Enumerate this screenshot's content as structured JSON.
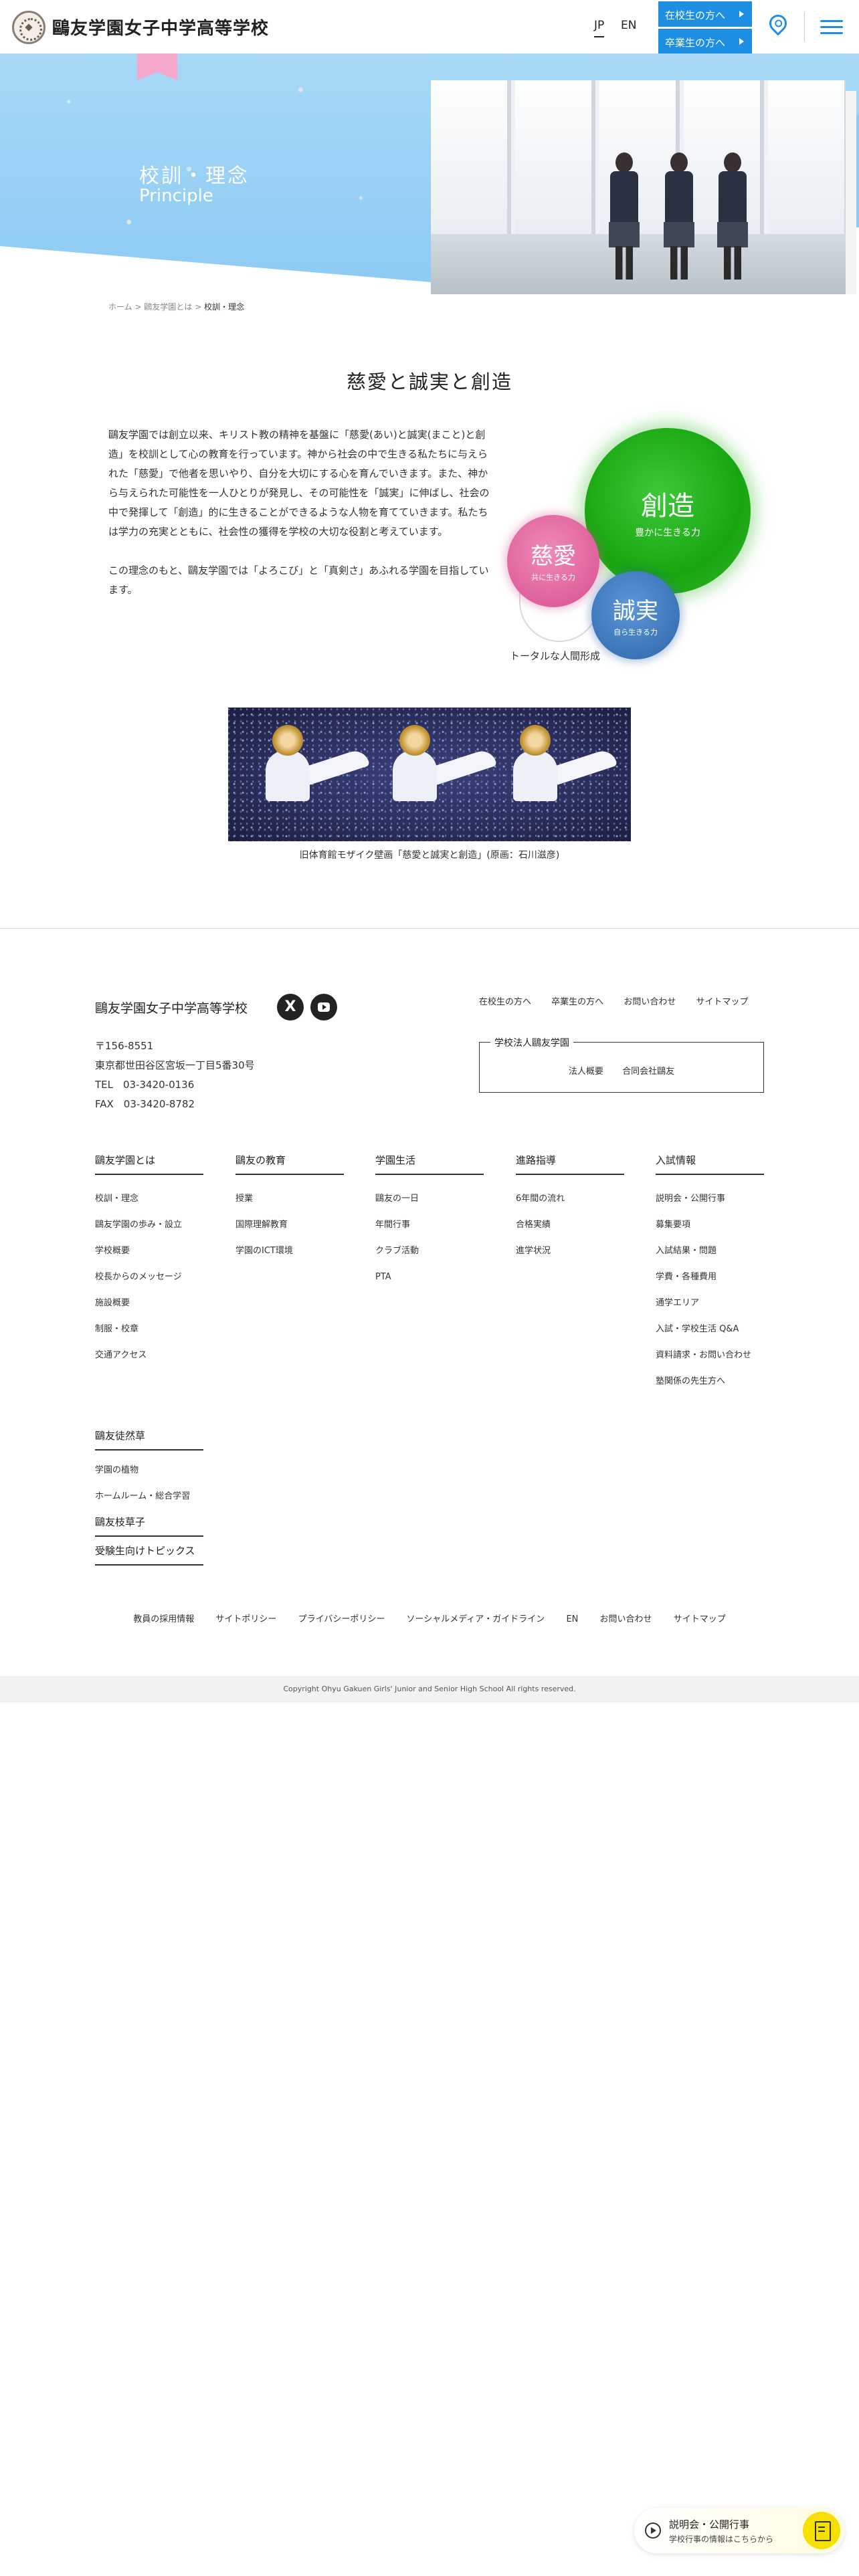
{
  "header": {
    "site_title": "鷗友学園女子中学高等学校",
    "lang_jp": "JP",
    "lang_en": "EN",
    "btn_current": "在校生の方へ",
    "btn_alumni": "卒業生の方へ",
    "accent_color": "#1e8ee3"
  },
  "hero": {
    "title": "校訓・理念",
    "subtitle": "Principle"
  },
  "breadcrumb": {
    "home": "ホーム",
    "parent": "鷗友学園とは",
    "current": "校訓・理念",
    "sep": ">"
  },
  "main": {
    "section_title": "慈愛と誠実と創造",
    "paragraph1": "鷗友学園では創立以来、キリスト教の精神を基盤に「慈愛(あい)と誠実(まこと)と創造」を校訓として心の教育を行っています。神から社会の中で生きる私たちに与えられた「慈愛」で他者を思いやり、自分を大切にする心を育んでいきます。また、神から与えられた可能性を一人ひとりが発見し、その可能性を「誠実」に伸ばし、社会の中で発揮して「創造」的に生きることができるような人物を育てていきます。私たちは学力の充実とともに、社会性の獲得を学校の大切な役割と考えています。",
    "paragraph2": "この理念のもと、鷗友学園では「よろこび」と「真剣さ」あふれる学園を目指しています。",
    "diagram": {
      "create_title": "創造",
      "create_sub": "豊かに生きる力",
      "love_title": "慈愛",
      "love_sub": "共に生きる力",
      "sincere_title": "誠実",
      "sincere_sub": "自ら生きる力",
      "caption": "トータルな人間形成",
      "colors": {
        "create": "#17a60f",
        "love": "#d74f8f",
        "sincere": "#2d64aa"
      }
    },
    "mosaic_caption": "旧体育館モザイク壁画「慈愛と誠実と創造」(原画：石川滋彦)"
  },
  "footer": {
    "school_name": "鷗友学園女子中学高等学校",
    "x_icon": "X",
    "postal": "〒156-8551",
    "address": "東京都世田谷区宮坂一丁目5番30号",
    "tel": "TEL　03-3420-0136",
    "fax": "FAX　03-3420-8782",
    "top_links": [
      "在校生の方へ",
      "卒業生の方へ",
      "お問い合わせ",
      "サイトマップ"
    ],
    "corp_title": "学校法人鷗友学園",
    "corp_links": [
      "法人概要",
      "合同会社鷗友"
    ],
    "columns": [
      {
        "title": "鷗友学園とは",
        "items": [
          "校訓・理念",
          "鷗友学園の歩み・設立",
          "学校概要",
          "校長からのメッセージ",
          "施設概要",
          "制服・校章",
          "交通アクセス"
        ]
      },
      {
        "title": "鷗友の教育",
        "items": [
          "授業",
          "国際理解教育",
          "学園のICT環境"
        ]
      },
      {
        "title": "学園生活",
        "items": [
          "鷗友の一日",
          "年間行事",
          "クラブ活動",
          "PTA"
        ]
      },
      {
        "title": "進路指導",
        "items": [
          "6年間の流れ",
          "合格実績",
          "進学状況"
        ]
      },
      {
        "title": "入試情報",
        "items": [
          "説明会・公開行事",
          "募集要項",
          "入試結果・問題",
          "学費・各種費用",
          "通学エリア",
          "入試・学校生活 Q&A",
          "資料請求・お問い合わせ",
          "塾関係の先生方へ"
        ]
      }
    ],
    "extra": {
      "title1": "鷗友徒然草",
      "items1": [
        "学園の植物",
        "ホームルーム・総合学習"
      ],
      "title2": "鷗友枝草子",
      "title3": "受験生向けトピックス"
    },
    "bottom_links": [
      "教員の採用情報",
      "サイトポリシー",
      "プライバシーポリシー",
      "ソーシャルメディア・ガイドライン",
      "EN",
      "お問い合わせ",
      "サイトマップ"
    ],
    "copyright": "Copyright Ohyu Gakuen Girls' Junior and Senior High School All rights reserved."
  },
  "floating": {
    "title": "説明会・公開行事",
    "subtitle": "学校行事の情報はこちらから"
  }
}
